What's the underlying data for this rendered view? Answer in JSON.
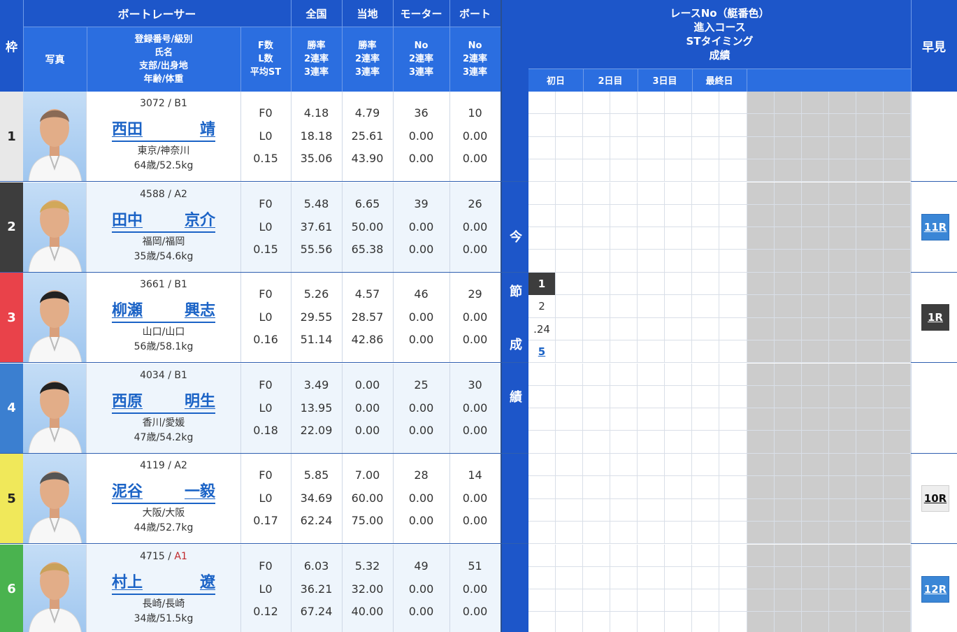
{
  "header": {
    "waku": "枠",
    "boat_racer": "ボートレーサー",
    "photo": "写真",
    "racer_info": [
      "登録番号/級別",
      "氏名",
      "支部/出身地",
      "年齢/体重"
    ],
    "f_l_st": [
      "F数",
      "L数",
      "平均ST"
    ],
    "national": "全国",
    "local": "当地",
    "motor": "モーター",
    "boat": "ボート",
    "rate_lines": [
      "勝率",
      "2連率",
      "3連率"
    ],
    "no_lines": [
      "No",
      "2連率",
      "3連率"
    ],
    "race_info": [
      "レースNo（艇番色）",
      "進入コース",
      "STタイミング",
      "成績"
    ],
    "days": [
      "初日",
      "2日目",
      "3日目",
      "最終日"
    ],
    "early": "早見"
  },
  "side_label": [
    "今",
    "節",
    "成",
    "績"
  ],
  "racers": [
    {
      "waku": "1",
      "waku_bg": "#e8e8e8",
      "waku_fg": "#222",
      "reg": "3072",
      "cls": "B1",
      "cls_red": false,
      "name1": "西田",
      "name2": "靖",
      "home": "東京/神奈川",
      "age": "64歳/52.5kg",
      "f": "F0",
      "l": "L0",
      "st": "0.15",
      "nat": [
        "4.18",
        "18.18",
        "35.06"
      ],
      "loc": [
        "4.79",
        "25.61",
        "43.90"
      ],
      "motor": [
        "36",
        "0.00",
        "0.00"
      ],
      "boat": [
        "10",
        "0.00",
        "0.00"
      ],
      "early": "",
      "early_style": ""
    },
    {
      "waku": "2",
      "waku_bg": "#3d3d3d",
      "waku_fg": "#fff",
      "reg": "4588",
      "cls": "A2",
      "cls_red": false,
      "name1": "田中",
      "name2": "京介",
      "home": "福岡/福岡",
      "age": "35歳/54.6kg",
      "f": "F0",
      "l": "L0",
      "st": "0.15",
      "nat": [
        "5.48",
        "37.61",
        "55.56"
      ],
      "loc": [
        "6.65",
        "50.00",
        "65.38"
      ],
      "motor": [
        "39",
        "0.00",
        "0.00"
      ],
      "boat": [
        "26",
        "0.00",
        "0.00"
      ],
      "early": "11R",
      "early_style": "blue"
    },
    {
      "waku": "3",
      "waku_bg": "#e9424a",
      "waku_fg": "#fff",
      "reg": "3661",
      "cls": "B1",
      "cls_red": false,
      "name1": "柳瀬",
      "name2": "興志",
      "home": "山口/山口",
      "age": "56歳/58.1kg",
      "f": "F0",
      "l": "L0",
      "st": "0.16",
      "nat": [
        "5.26",
        "29.55",
        "51.14"
      ],
      "loc": [
        "4.57",
        "28.57",
        "42.86"
      ],
      "motor": [
        "46",
        "0.00",
        "0.00"
      ],
      "boat": [
        "29",
        "0.00",
        "0.00"
      ],
      "early": "1R",
      "early_style": "dark",
      "result": {
        "race": "1",
        "course": "2",
        "st": ".24",
        "finish": "5"
      }
    },
    {
      "waku": "4",
      "waku_bg": "#3b7fd0",
      "waku_fg": "#fff",
      "reg": "4034",
      "cls": "B1",
      "cls_red": false,
      "name1": "西原",
      "name2": "明生",
      "home": "香川/愛媛",
      "age": "47歳/54.2kg",
      "f": "F0",
      "l": "L0",
      "st": "0.18",
      "nat": [
        "3.49",
        "13.95",
        "22.09"
      ],
      "loc": [
        "0.00",
        "0.00",
        "0.00"
      ],
      "motor": [
        "25",
        "0.00",
        "0.00"
      ],
      "boat": [
        "30",
        "0.00",
        "0.00"
      ],
      "early": "",
      "early_style": ""
    },
    {
      "waku": "5",
      "waku_bg": "#f0e85a",
      "waku_fg": "#222",
      "reg": "4119",
      "cls": "A2",
      "cls_red": false,
      "name1": "泥谷",
      "name2": "一毅",
      "home": "大阪/大阪",
      "age": "44歳/52.7kg",
      "f": "F0",
      "l": "L0",
      "st": "0.17",
      "nat": [
        "5.85",
        "34.69",
        "62.24"
      ],
      "loc": [
        "7.00",
        "60.00",
        "75.00"
      ],
      "motor": [
        "28",
        "0.00",
        "0.00"
      ],
      "boat": [
        "14",
        "0.00",
        "0.00"
      ],
      "early": "10R",
      "early_style": "light"
    },
    {
      "waku": "6",
      "waku_bg": "#4ab34f",
      "waku_fg": "#fff",
      "reg": "4715",
      "cls": "A1",
      "cls_red": true,
      "name1": "村上",
      "name2": "遼",
      "home": "長崎/長崎",
      "age": "34歳/51.5kg",
      "f": "F0",
      "l": "L0",
      "st": "0.12",
      "nat": [
        "6.03",
        "36.21",
        "67.24"
      ],
      "loc": [
        "5.32",
        "32.00",
        "40.00"
      ],
      "motor": [
        "49",
        "0.00",
        "0.00"
      ],
      "boat": [
        "51",
        "0.00",
        "0.00"
      ],
      "early": "12R",
      "early_style": "blue"
    }
  ]
}
